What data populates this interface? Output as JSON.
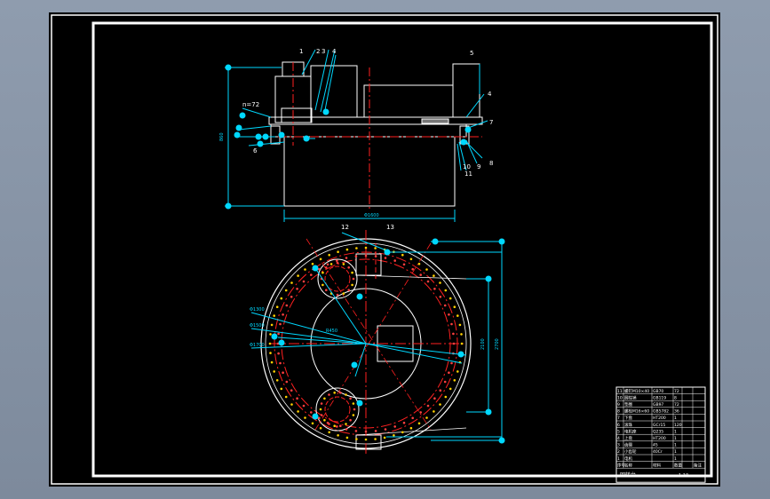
{
  "drawing": {
    "side_view_labels": {
      "p1": "1",
      "p2": "2",
      "p3": "3",
      "p4a": "4",
      "p5": "5",
      "p4b": "4",
      "p7": "7",
      "p8": "8",
      "p9": "9",
      "p10": "10",
      "p11": "11",
      "p6": "6"
    },
    "top_view_labels": {
      "p12": "12",
      "p13": "13"
    },
    "dimensions": {
      "thread_note": "n=72",
      "overall_width": "Φ1600",
      "height": "860",
      "diameter_1": "Φ1300",
      "diameter_2": "Φ1500",
      "diameter_3": "Φ1700",
      "length_1": "2100",
      "length_2": "2700",
      "radius": "R450"
    },
    "title_block": {
      "rows": [
        [
          "11",
          "螺钉M10×40",
          "GB70",
          "72",
          "",
          ""
        ],
        [
          "10",
          "圆柱销",
          "GB119",
          "8",
          "",
          ""
        ],
        [
          "9",
          "垫圈",
          "GB97",
          "72",
          "",
          ""
        ],
        [
          "8",
          "螺栓M16×60",
          "GB5782",
          "36",
          "",
          ""
        ],
        [
          "7",
          "下盘",
          "HT200",
          "1",
          "",
          ""
        ],
        [
          "6",
          "滚珠",
          "GCr15",
          "120",
          "",
          ""
        ],
        [
          "5",
          "电机座",
          "Q235",
          "1",
          "",
          ""
        ],
        [
          "4",
          "上盘",
          "HT200",
          "1",
          "",
          ""
        ],
        [
          "3",
          "齿圈",
          "45",
          "1",
          "",
          ""
        ],
        [
          "2",
          "小齿轮",
          "40Cr",
          "1",
          "",
          ""
        ],
        [
          "1",
          "电机",
          "",
          "1",
          "",
          ""
        ],
        [
          "序号",
          "名称",
          "材料",
          "数量",
          "",
          "备注"
        ]
      ],
      "footer_name": "回转台",
      "footer_ratio": "1:10"
    }
  }
}
